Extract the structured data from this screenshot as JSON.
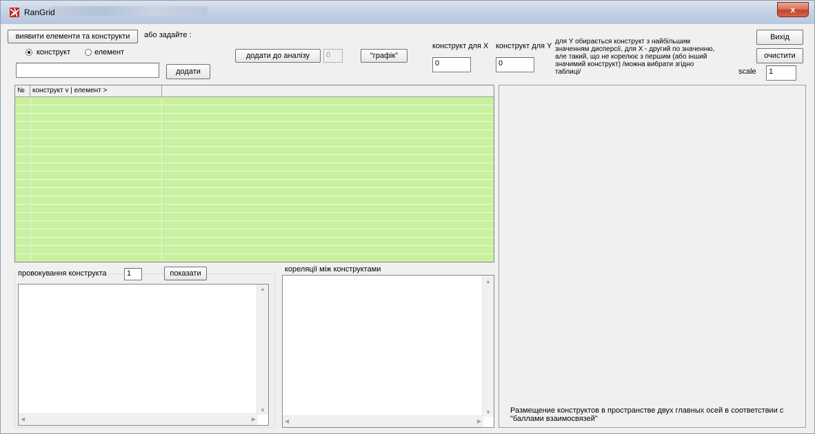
{
  "window": {
    "title": "RanGrid",
    "close": "x"
  },
  "top": {
    "detect_button": "виявити елементи та конструкти",
    "or_set_label": "або задайте :",
    "radio_construct": "конструкт",
    "radio_element": "елемент",
    "add_input_value": "",
    "add_button": "додати",
    "add_to_analysis_button": "додати до аналізу",
    "analysis_value": "0",
    "graph_button": "\"графік\"",
    "construct_x_label": "конструкт для X",
    "construct_x_value": "0",
    "construct_y_label": "конструкт для Y",
    "construct_y_value": "0",
    "note_lines": [
      "для Y обирається конструкт з найбільшим",
      "значенням дисперсії, для X - другий по значенню,",
      "але такий, що не корелює з першим (або інший",
      "значимий конструкт)  /можна вибрати згідно",
      "таблиці/"
    ],
    "exit_button": "Вихід",
    "clear_button": "очистити",
    "scale_label": "scale",
    "scale_value": "1"
  },
  "grid": {
    "col_num": "№",
    "col_construct": "конструкт v | елемент >"
  },
  "probe": {
    "label": "провокування конструкта",
    "value": "1",
    "show_button": "показати"
  },
  "correlations": {
    "label": "кореляції між конструктами"
  },
  "plot": {
    "caption_lines": [
      "Размещение конструктов в пространстве двух главных осей в соответствии с",
      "\"баллами взаимосвязей\""
    ]
  }
}
